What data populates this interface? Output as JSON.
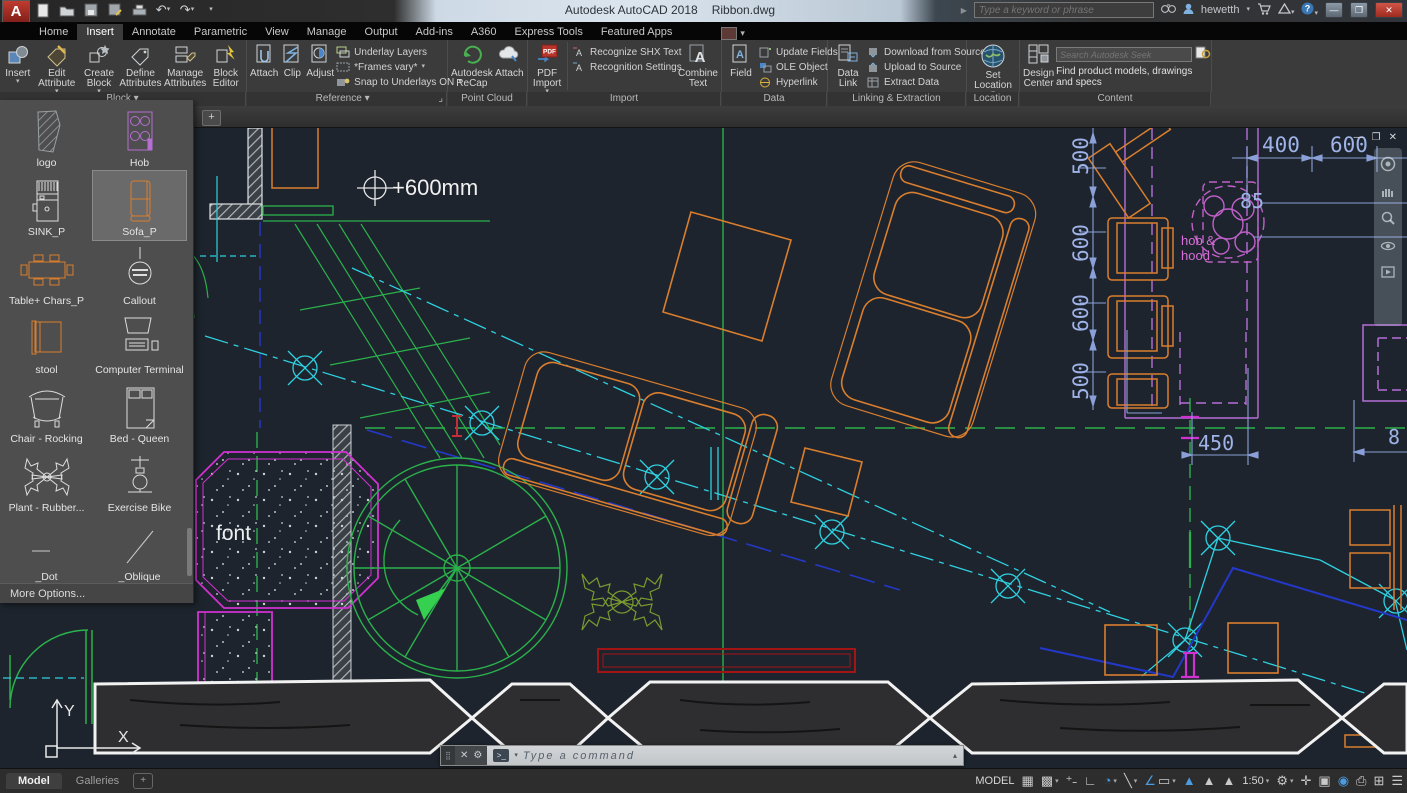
{
  "title_bar": {
    "app_title": "Autodesk AutoCAD 2018",
    "doc_title": "Ribbon.dwg",
    "search_placeholder": "Type a keyword or phrase",
    "username": "hewetth"
  },
  "tabs": {
    "items": [
      {
        "label": "Home"
      },
      {
        "label": "Insert"
      },
      {
        "label": "Annotate"
      },
      {
        "label": "Parametric"
      },
      {
        "label": "View"
      },
      {
        "label": "Manage"
      },
      {
        "label": "Output"
      },
      {
        "label": "Add-ins"
      },
      {
        "label": "A360"
      },
      {
        "label": "Express Tools"
      },
      {
        "label": "Featured Apps"
      }
    ]
  },
  "ribbon": {
    "block": {
      "name": "Block",
      "insert": "Insert",
      "edit_attribute": "Edit\nAttribute",
      "create_block": "Create\nBlock",
      "define_attributes": "Define\nAttributes",
      "manage_attributes": "Manage\nAttributes",
      "block_editor": "Block\nEditor"
    },
    "reference": {
      "name": "Reference",
      "attach": "Attach",
      "clip": "Clip",
      "adjust": "Adjust",
      "underlay_layers": "Underlay Layers",
      "frames": "*Frames vary*",
      "snap": "Snap to Underlays ON"
    },
    "point_cloud": {
      "name": "Point Cloud",
      "recap": "Autodesk\nReCap",
      "attach": "Attach"
    },
    "import": {
      "name": "Import",
      "pdf_import": "PDF\nImport",
      "recognize": "Recognize SHX Text",
      "settings": "Recognition Settings",
      "combine": "Combine\nText"
    },
    "data": {
      "name": "Data",
      "field": "Field",
      "update_fields": "Update Fields",
      "ole_object": "OLE Object",
      "hyperlink": "Hyperlink"
    },
    "linking": {
      "name": "Linking & Extraction",
      "data_link": "Data\nLink",
      "download": "Download from Source",
      "upload": "Upload to Source",
      "extract": "Extract  Data"
    },
    "location": {
      "name": "Location",
      "set_location": "Set\nLocation"
    },
    "content": {
      "name": "Content",
      "design_center": "Design\nCenter",
      "seek_placeholder": "Search Autodesk Seek",
      "caption": "Find product models, drawings and specs"
    }
  },
  "palette": {
    "items": [
      {
        "label": "logo"
      },
      {
        "label": "Hob"
      },
      {
        "label": "SINK_P"
      },
      {
        "label": "Sofa_P"
      },
      {
        "label": "Table+ Chars_P"
      },
      {
        "label": "Callout"
      },
      {
        "label": "stool"
      },
      {
        "label": "Computer Terminal"
      },
      {
        "label": "Chair - Rocking"
      },
      {
        "label": "Bed - Queen"
      },
      {
        "label": "Plant - Rubber..."
      },
      {
        "label": "Exercise Bike"
      },
      {
        "label": "_Dot"
      },
      {
        "label": "_Oblique"
      }
    ],
    "more_options": "More Options..."
  },
  "drawing": {
    "level_label": "+600mm",
    "font_label": "font",
    "hob_label_line1": "hob &",
    "hob_label_line2": "hood",
    "dims": {
      "d400": "400",
      "d600_top": "600",
      "d85": "85",
      "d450": "450",
      "d8": "8",
      "v500_a": "500",
      "v600_a": "600",
      "v600_b": "600",
      "v500_b": "500"
    }
  },
  "command_line": {
    "placeholder": "Type a command"
  },
  "status_bar": {
    "model_tab": "Model",
    "galleries_tab": "Galleries",
    "space_label": "MODEL",
    "scale": "1:50"
  },
  "colors": {
    "canvas_bg": "#1d242d",
    "entity_orange": "#d97e2e",
    "entity_green": "#2bb14c",
    "entity_cyan": "#2fd0e0",
    "entity_magenta": "#d231d2",
    "counter_purple": "#b56fd8",
    "dim_blue": "#8ba0d8",
    "entity_red": "#a31515",
    "plant_olive": "#7a9a30"
  }
}
